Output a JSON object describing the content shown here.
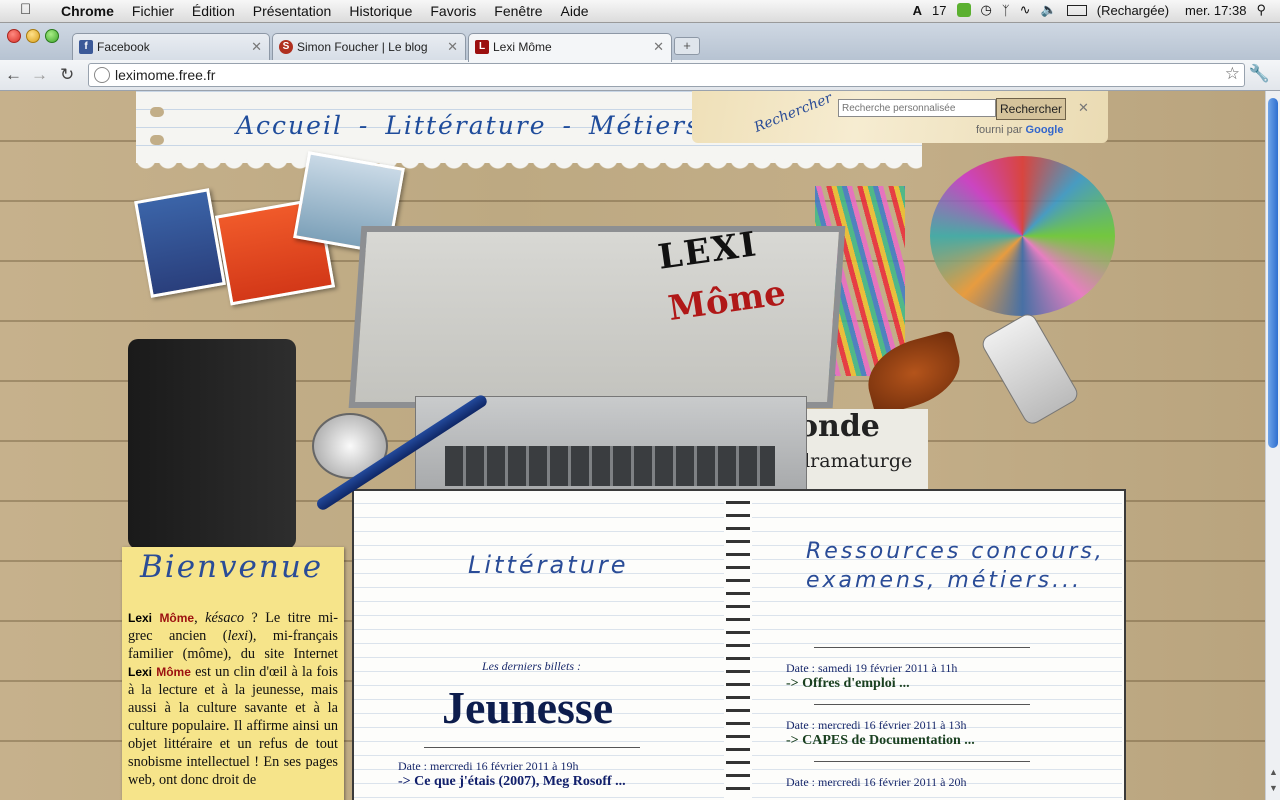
{
  "menubar": {
    "apple": "",
    "items": [
      "Chrome",
      "Fichier",
      "Édition",
      "Présentation",
      "Historique",
      "Favoris",
      "Fenêtre",
      "Aide"
    ],
    "status": {
      "adobe_count": "17",
      "battery": "(Rechargée)",
      "clock": "mer. 17:38"
    }
  },
  "tabs": [
    {
      "label": "Facebook",
      "favicon": "f",
      "color": "#3b5998"
    },
    {
      "label": "Simon Foucher | Le blog",
      "favicon": "S",
      "color": "#b03020"
    },
    {
      "label": "Lexi Môme",
      "favicon": "L",
      "color": "#9c1010"
    }
  ],
  "toolbar": {
    "url": "leximome.free.fr"
  },
  "site": {
    "nav": {
      "home": "Accueil",
      "literature": "Littérature",
      "careers": "Métiers",
      "sep": "-"
    },
    "search": {
      "side_label": "Rechercher",
      "placeholder": "Recherche personnalisée",
      "button": "Rechercher",
      "powered_prefix": "fourni par",
      "powered_brand": "Google"
    },
    "laptop": {
      "logo_top": "LEXI",
      "logo_bottom": "Môme"
    },
    "newspaper": {
      "big": "onde",
      "small": "dramaturge"
    },
    "welcome": {
      "title": "Bienvenue",
      "brand_a": "Lexi",
      "brand_b": "Môme",
      "p1": ", ",
      "kesaco": "késaco",
      "p2": " ? Le titre mi-grec ancien (",
      "lexi": "lexi",
      "p3": "), mi-français familier (môme), du site Internet ",
      "p4": " est un clin d'œil à la fois à la lecture et à la jeunesse, mais aussi à la culture savante et à la culture populaire. Il affirme ainsi un objet littéraire et un refus de tout snobisme intellectuel ! En ses pages web, ont donc droit de"
    },
    "literature": {
      "title": "Littérature",
      "recent_label": "Les derniers billets :",
      "category": "Jeunesse",
      "posts": [
        {
          "date": "Date : mercredi 16 février 2011 à 19h",
          "title": "-> Ce que j'étais (2007), Meg Rosoff ..."
        }
      ]
    },
    "resources": {
      "title_line1": "Ressources concours,",
      "title_line2": "examens, métiers...",
      "posts": [
        {
          "date": "Date : samedi 19 février 2011 à 11h",
          "title": "-> Offres d'emploi ..."
        },
        {
          "date": "Date : mercredi 16 février 2011 à 13h",
          "title": "-> CAPES de Documentation ..."
        },
        {
          "date": "Date : mercredi 16 février 2011 à 20h",
          "title": ""
        }
      ]
    }
  },
  "colors": {
    "nav_blue": "#1f4c9b",
    "brand_red": "#9c1010",
    "postit": "#f6e48a"
  }
}
